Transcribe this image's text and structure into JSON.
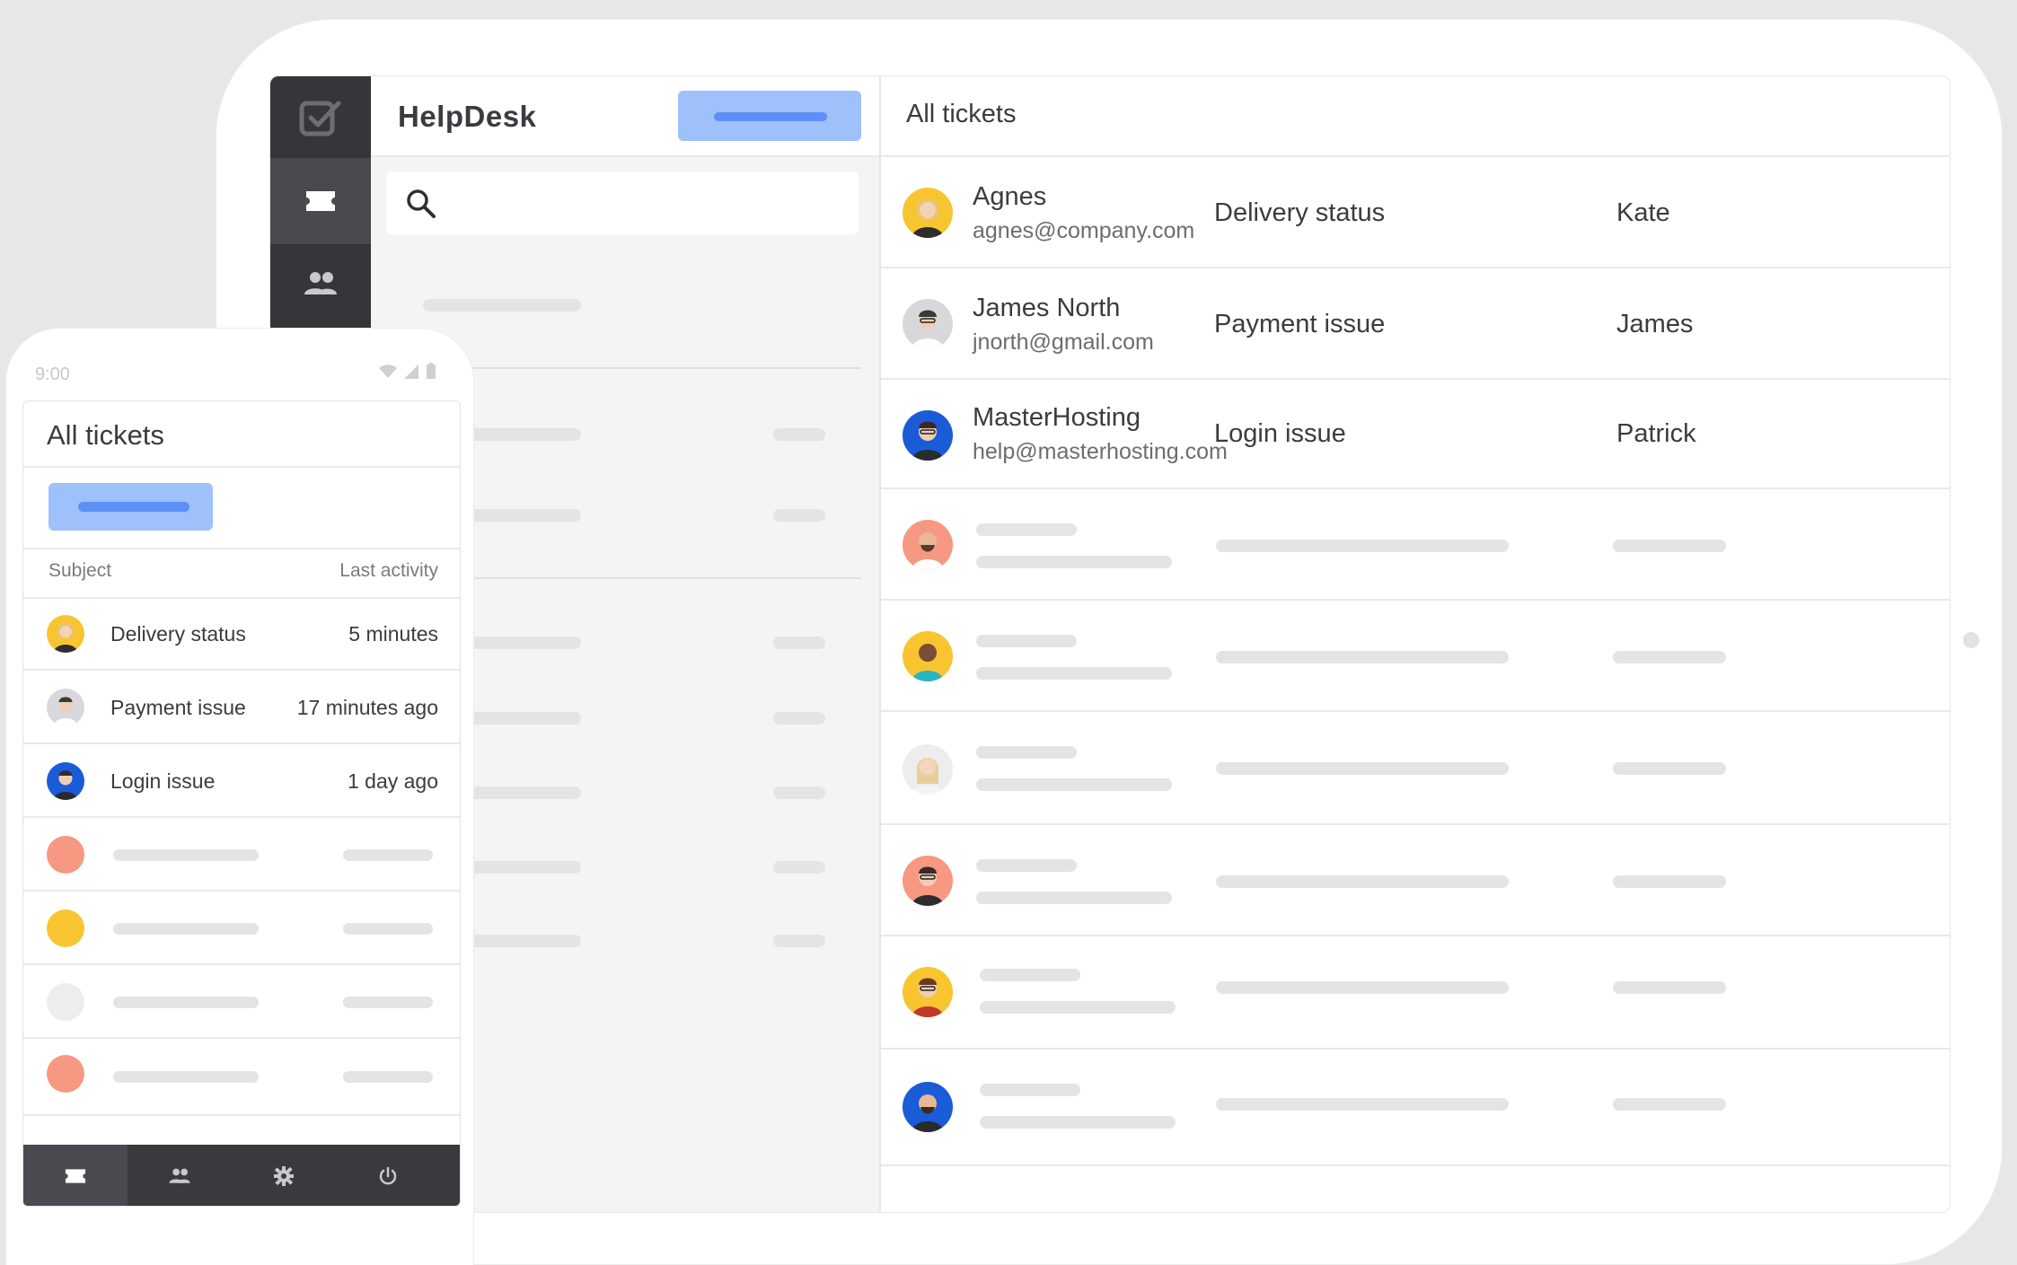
{
  "desktop": {
    "app_title": "HelpDesk",
    "list_title": "All tickets",
    "tickets": [
      {
        "name": "Agnes",
        "email": "agnes@company.com",
        "subject": "Delivery status",
        "agent": "Kate"
      },
      {
        "name": "James North",
        "email": "jnorth@gmail.com",
        "subject": "Payment issue",
        "agent": "James"
      },
      {
        "name": "MasterHosting",
        "email": "help@masterhosting.com",
        "subject": "Login issue",
        "agent": "Patrick"
      }
    ],
    "sidebar_icons": [
      "checkbox-icon",
      "ticket-icon",
      "people-icon"
    ],
    "search_icon": "search-icon"
  },
  "mobile": {
    "time": "9:00",
    "title": "All tickets",
    "columns": {
      "subject": "Subject",
      "last_activity": "Last activity"
    },
    "tickets": [
      {
        "subject": "Delivery status",
        "time": "5 minutes"
      },
      {
        "subject": "Payment issue",
        "time": "17 minutes ago"
      },
      {
        "subject": "Login issue",
        "time": "1 day ago"
      }
    ],
    "nav_icons": [
      "ticket-icon",
      "people-icon",
      "gear-icon",
      "power-icon"
    ]
  },
  "colors": {
    "accent_light": "#9ec0fb",
    "accent": "#5d8ff7",
    "sidebar": "#363539",
    "avatar_yellow": "#f8c531",
    "avatar_gray": "#d8d8dc",
    "avatar_blue": "#1a5bd8",
    "avatar_salmon": "#f79882"
  }
}
